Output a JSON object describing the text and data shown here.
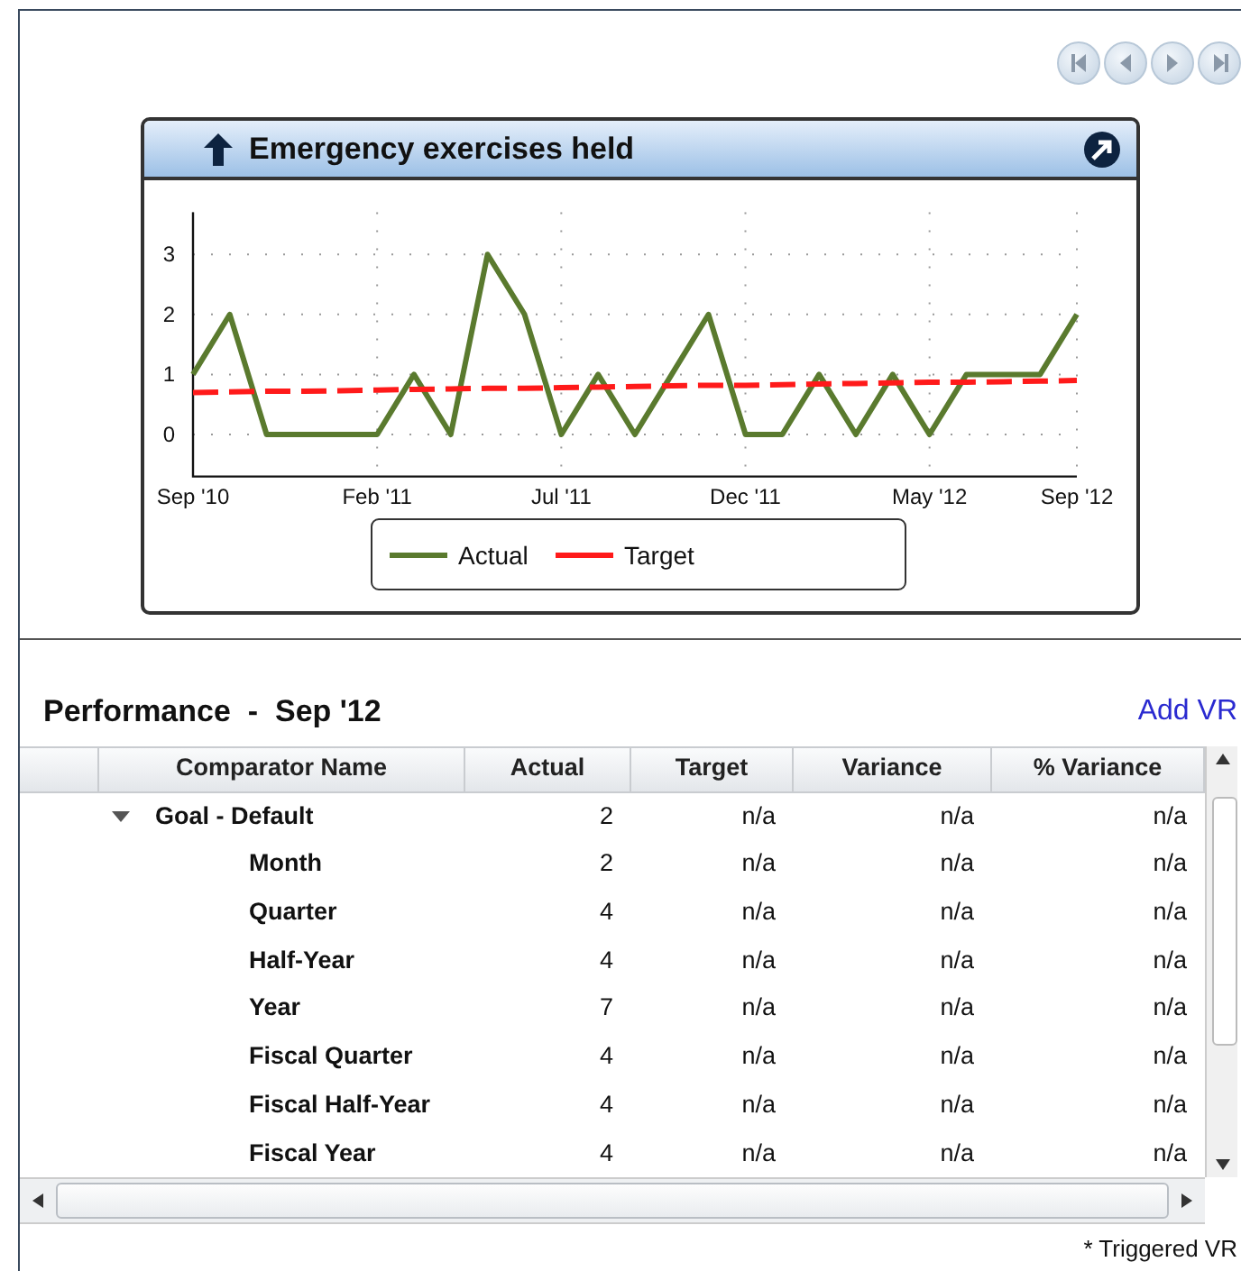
{
  "pager": {
    "buttons": [
      {
        "kind": "first"
      },
      {
        "kind": "previous"
      },
      {
        "kind": "next"
      },
      {
        "kind": "last"
      }
    ]
  },
  "chart_card": {
    "title": "Emergency exercises held",
    "chart_data": {
      "type": "line",
      "categories": [
        "Sep '10",
        null,
        null,
        null,
        null,
        "Feb '11",
        null,
        null,
        null,
        null,
        "Jul '11",
        null,
        null,
        null,
        null,
        "Dec '11",
        null,
        null,
        null,
        null,
        "May '12",
        null,
        null,
        null,
        "Sep '12"
      ],
      "yticks": [
        0,
        1,
        2,
        3
      ],
      "ylim": [
        -0.7,
        3.7
      ],
      "grid": true,
      "legend": true,
      "series": [
        {
          "name": "Actual",
          "color": "#5a7a2e",
          "line_style": "solid",
          "values": [
            1,
            2,
            0,
            0,
            0,
            0,
            1,
            0,
            3,
            2,
            0,
            1,
            0,
            1,
            2,
            0,
            0,
            1,
            0,
            1,
            0,
            1,
            1,
            1,
            2
          ]
        },
        {
          "name": "Target",
          "color": "#ff1a1a",
          "line_style": "dashed",
          "values": [
            0.7,
            0.71,
            0.72,
            0.72,
            0.73,
            0.74,
            0.75,
            0.76,
            0.77,
            0.77,
            0.78,
            0.79,
            0.8,
            0.81,
            0.82,
            0.82,
            0.83,
            0.84,
            0.85,
            0.86,
            0.87,
            0.87,
            0.88,
            0.89,
            0.9
          ]
        }
      ]
    }
  },
  "performance": {
    "title": "Performance  -  Sep '12",
    "link": "Add VR",
    "columns": [
      "Comparator Name",
      "Actual",
      "Target",
      "Variance",
      "% Variance"
    ],
    "rows": [
      {
        "name": "Goal - Default",
        "actual": "2",
        "target": "n/a",
        "variance": "n/a",
        "pct_variance": "n/a",
        "expanded": true,
        "children": [
          {
            "name": "Month",
            "actual": "2",
            "target": "n/a",
            "variance": "n/a",
            "pct_variance": "n/a"
          },
          {
            "name": "Quarter",
            "actual": "4",
            "target": "n/a",
            "variance": "n/a",
            "pct_variance": "n/a"
          },
          {
            "name": "Half-Year",
            "actual": "4",
            "target": "n/a",
            "variance": "n/a",
            "pct_variance": "n/a"
          },
          {
            "name": "Year",
            "actual": "7",
            "target": "n/a",
            "variance": "n/a",
            "pct_variance": "n/a"
          },
          {
            "name": "Fiscal Quarter",
            "actual": "4",
            "target": "n/a",
            "variance": "n/a",
            "pct_variance": "n/a"
          },
          {
            "name": "Fiscal Half-Year",
            "actual": "4",
            "target": "n/a",
            "variance": "n/a",
            "pct_variance": "n/a"
          },
          {
            "name": "Fiscal Year",
            "actual": "4",
            "target": "n/a",
            "variance": "n/a",
            "pct_variance": "n/a"
          }
        ]
      }
    ],
    "footnote": "* Triggered VR"
  }
}
